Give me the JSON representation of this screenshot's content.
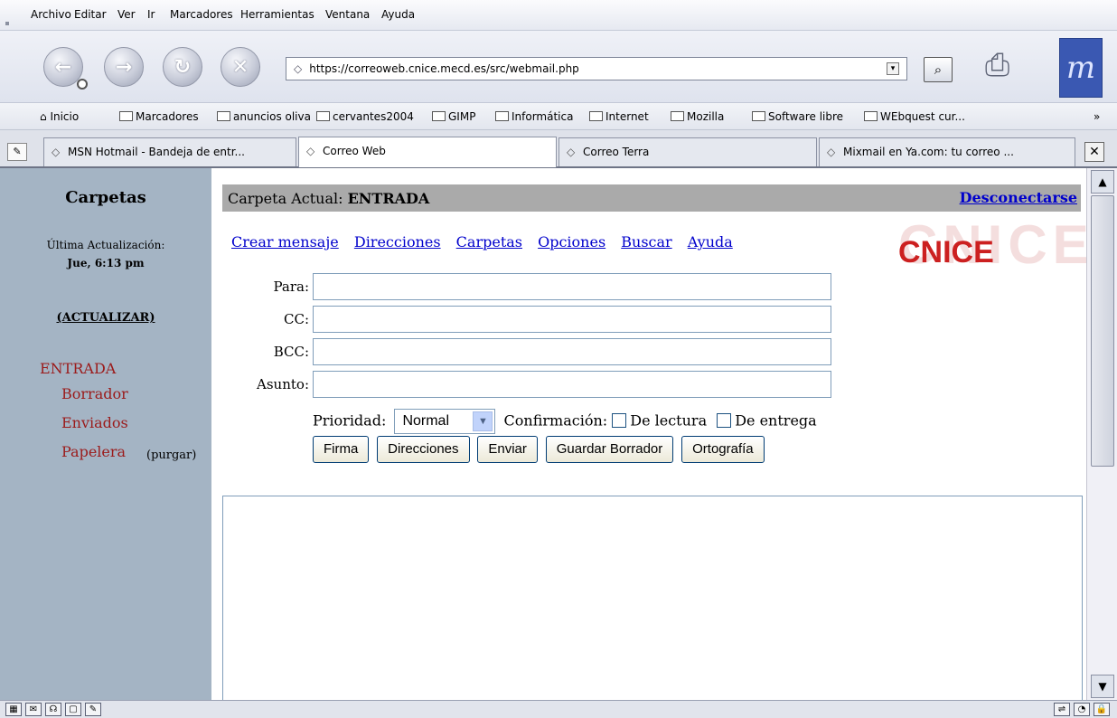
{
  "menu": [
    "Archivo",
    "Editar",
    "Ver",
    "Ir",
    "Marcadores",
    "Herramientas",
    "Ventana",
    "Ayuda"
  ],
  "nav": {
    "back_icon": "back-arrow-icon",
    "forward_icon": "forward-arrow-icon",
    "reload_icon": "reload-icon",
    "stop_icon": "stop-icon",
    "url": "https://correoweb.cnice.mecd.es/src/webmail.php"
  },
  "bookmarks": {
    "home": "Inicio",
    "items": [
      "Marcadores",
      "anuncios oliva",
      "cervantes2004",
      "GIMP",
      "Informática",
      "Internet",
      "Mozilla",
      "Software libre",
      "WEbquest cur..."
    ],
    "more": "»"
  },
  "tabs": [
    {
      "label": "MSN Hotmail - Bandeja de entr...",
      "active": false
    },
    {
      "label": "Correo Web",
      "active": true
    },
    {
      "label": "Correo Terra",
      "active": false
    },
    {
      "label": "Mixmail en Ya.com: tu correo ...",
      "active": false
    }
  ],
  "sidebar": {
    "title": "Carpetas",
    "last_update_label": "Última Actualización:",
    "last_update_time": "Jue, 6:13 pm",
    "refresh": "(ACTUALIZAR)",
    "folders": [
      "ENTRADA",
      "Borrador",
      "Enviados",
      "Papelera"
    ],
    "purge": "(purgar)"
  },
  "header": {
    "current_folder_label": "Carpeta Actual:",
    "current_folder": "ENTRADA",
    "logout": "Desconectarse"
  },
  "links": [
    "Crear mensaje",
    "Direcciones",
    "Carpetas",
    "Opciones",
    "Buscar",
    "Ayuda"
  ],
  "logo": {
    "ghost": "CNICE",
    "text": "CNICE"
  },
  "form": {
    "to_label": "Para:",
    "cc_label": "CC:",
    "bcc_label": "BCC:",
    "subject_label": "Asunto:",
    "priority_label": "Prioridad:",
    "priority_value": "Normal",
    "confirmation_label": "Confirmación:",
    "read_receipt": "De lectura",
    "delivery_receipt": "De entrega",
    "buttons": [
      "Firma",
      "Direcciones",
      "Enviar",
      "Guardar Borrador",
      "Ortografía"
    ]
  }
}
